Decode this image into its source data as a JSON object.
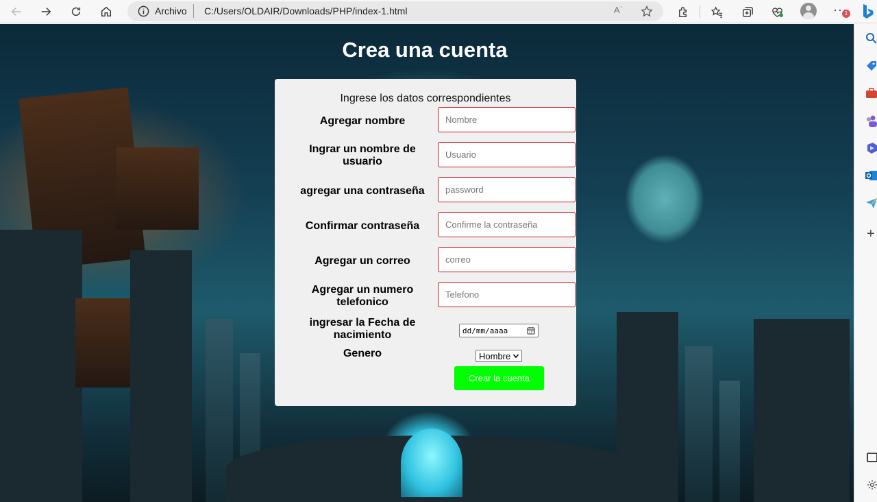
{
  "browser": {
    "scheme_label": "Archivo",
    "url": "C:/Users/OLDAIR/Downloads/PHP/index-1.html",
    "read_aloud_label": "Aʾ",
    "notification_count": "1",
    "icons": {
      "back": "back-arrow-icon",
      "forward": "forward-arrow-icon",
      "refresh": "refresh-icon",
      "home": "home-icon",
      "info": "info-icon",
      "favorite": "star-icon",
      "extensions": "puzzle-icon",
      "favorites": "favorites-icon",
      "collections": "collections-icon",
      "performance": "heart-pulse-icon",
      "profile": "profile-icon",
      "more": "more-dots-icon",
      "bing": "bing-chat-icon"
    }
  },
  "sidebar": {
    "icons": [
      "search-icon",
      "shopping-tag-icon",
      "toolbox-icon",
      "people-icon",
      "copilot-icon",
      "outlook-icon",
      "send-icon",
      "add-icon",
      "split-screen-icon",
      "settings-icon"
    ]
  },
  "page": {
    "title": "Crea una cuenta",
    "form": {
      "subtitle": "Ingrese los datos correspondientes",
      "fields": [
        {
          "label": "Agregar nombre",
          "placeholder": "Nombre"
        },
        {
          "label": "Ingrar un nombre de usuario",
          "placeholder": "Usuario"
        },
        {
          "label": "agregar una contraseña",
          "placeholder": "password"
        },
        {
          "label": "Confirmar contraseña",
          "placeholder": "Confirme la contraseña"
        },
        {
          "label": "Agregar un correo",
          "placeholder": "correo"
        },
        {
          "label": "Agregar un numero telefonico",
          "placeholder": "Telefono"
        }
      ],
      "birthdate": {
        "label": "ingresar la Fecha de nacimiento",
        "value": "dd/mm/aaaa"
      },
      "gender": {
        "label": "Genero",
        "selected": "Hombre"
      },
      "submit_label": "Crear la cuenta",
      "colors": {
        "input_border": "#c7161e",
        "button_bg": "#00ff00",
        "card_bg": "#f0f0f0"
      }
    }
  }
}
